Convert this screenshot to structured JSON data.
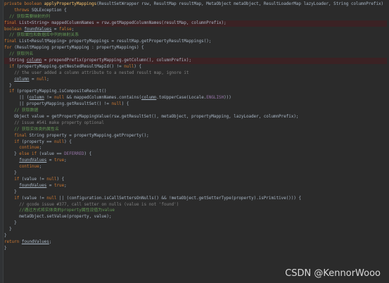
{
  "code_lines": [
    {
      "hl": false,
      "tokens": [
        [
          "kw",
          "private boolean "
        ],
        [
          "fn",
          "applyPropertyMappings"
        ],
        [
          "pl",
          "(ResultSetWrapper rsw, ResultMap resultMap, MetaObject metaObject, ResultLoaderMap lazyLoader, String columnPrefix)"
        ]
      ]
    },
    {
      "hl": false,
      "tokens": [
        [
          "pl",
          "    "
        ],
        [
          "kw",
          "throws "
        ],
        [
          "pl",
          "SQLException {"
        ]
      ]
    },
    {
      "hl": false,
      "tokens": [
        [
          "pl",
          "  "
        ],
        [
          "cmcn",
          "// 获取需要映射的列"
        ]
      ]
    },
    {
      "hl": true,
      "tokens": [
        [
          "kw",
          "final "
        ],
        [
          "pl",
          "List<String> mappedColumnNames = rsw.getMappedColumnNames(resultMap, columnPrefix);"
        ]
      ]
    },
    {
      "hl": false,
      "tokens": [
        [
          "kw",
          "boolean "
        ],
        [
          "un",
          "foundValues"
        ],
        [
          "pl",
          " = "
        ],
        [
          "kw",
          "false"
        ],
        [
          "pl",
          ";"
        ]
      ]
    },
    {
      "hl": false,
      "tokens": [
        [
          "pl",
          "  "
        ],
        [
          "cmcn",
          "// 获取属性和数据库中列的映射关系"
        ]
      ]
    },
    {
      "hl": false,
      "tokens": [
        [
          "kw",
          "final "
        ],
        [
          "pl",
          "List<ResultMapping> propertyMappings = resultMap.getPropertyResultMappings();"
        ]
      ]
    },
    {
      "hl": false,
      "tokens": [
        [
          "kw",
          "for "
        ],
        [
          "pl",
          "(ResultMapping propertyMapping : propertyMappings) {"
        ]
      ]
    },
    {
      "hl": false,
      "tokens": [
        [
          "pl",
          "  "
        ],
        [
          "cmcn",
          "// 获取列名"
        ]
      ]
    },
    {
      "hl": true,
      "tokens": [
        [
          "pl",
          "  String "
        ],
        [
          "un",
          "column"
        ],
        [
          "pl",
          " = prependPrefix(propertyMapping.getColumn(), columnPrefix);"
        ]
      ]
    },
    {
      "hl": false,
      "tokens": [
        [
          "pl",
          "  "
        ],
        [
          "kw",
          "if "
        ],
        [
          "pl",
          "(propertyMapping.getNestedResultMapId() != "
        ],
        [
          "kw",
          "null"
        ],
        [
          "pl",
          ") {"
        ]
      ]
    },
    {
      "hl": false,
      "tokens": [
        [
          "pl",
          "    "
        ],
        [
          "cm",
          "// the user added a column attribute to a nested result map, ignore it"
        ]
      ]
    },
    {
      "hl": false,
      "tokens": [
        [
          "pl",
          "    "
        ],
        [
          "un",
          "column"
        ],
        [
          "pl",
          " = "
        ],
        [
          "kw",
          "null"
        ],
        [
          "pl",
          ";"
        ]
      ]
    },
    {
      "hl": false,
      "tokens": [
        [
          "pl",
          "  }"
        ]
      ]
    },
    {
      "hl": false,
      "tokens": [
        [
          "pl",
          "  "
        ],
        [
          "kw",
          "if "
        ],
        [
          "pl",
          "(propertyMapping.isCompositeResult()"
        ]
      ]
    },
    {
      "hl": false,
      "tokens": [
        [
          "pl",
          "      || ("
        ],
        [
          "un",
          "column"
        ],
        [
          "pl",
          " != "
        ],
        [
          "kw",
          "null "
        ],
        [
          "pl",
          "&& mappedColumnNames.contains("
        ],
        [
          "un",
          "column"
        ],
        [
          "pl",
          ".toUpperCase(Locale."
        ],
        [
          "field",
          "ENGLISH"
        ],
        [
          "pl",
          ")))"
        ]
      ]
    },
    {
      "hl": false,
      "tokens": [
        [
          "pl",
          "      || propertyMapping.getResultSet() != "
        ],
        [
          "kw",
          "null"
        ],
        [
          "pl",
          ") {"
        ]
      ]
    },
    {
      "hl": false,
      "tokens": [
        [
          "pl",
          "    "
        ],
        [
          "cmcn",
          "// 获取数据"
        ]
      ]
    },
    {
      "hl": false,
      "tokens": [
        [
          "pl",
          "    Object value = getPropertyMappingValue(rsw.getResultSet(), metaObject, propertyMapping, lazyLoader, columnPrefix);"
        ]
      ]
    },
    {
      "hl": false,
      "tokens": [
        [
          "pl",
          "    "
        ],
        [
          "cm",
          "// issue #541 make property optional"
        ]
      ]
    },
    {
      "hl": false,
      "tokens": [
        [
          "pl",
          "    "
        ],
        [
          "cmcn",
          "// 获取实体类的属性名"
        ]
      ]
    },
    {
      "hl": false,
      "tokens": [
        [
          "pl",
          "    "
        ],
        [
          "kw",
          "final "
        ],
        [
          "pl",
          "String property = propertyMapping.getProperty();"
        ]
      ]
    },
    {
      "hl": false,
      "tokens": [
        [
          "pl",
          "    "
        ],
        [
          "kw",
          "if "
        ],
        [
          "pl",
          "(property == "
        ],
        [
          "kw",
          "null"
        ],
        [
          "pl",
          ") {"
        ]
      ]
    },
    {
      "hl": false,
      "tokens": [
        [
          "pl",
          "      "
        ],
        [
          "kw",
          "continue"
        ],
        [
          "pl",
          ";"
        ]
      ]
    },
    {
      "hl": false,
      "tokens": [
        [
          "pl",
          "    } "
        ],
        [
          "kw",
          "else if "
        ],
        [
          "pl",
          "(value == "
        ],
        [
          "field",
          "DEFERRED"
        ],
        [
          "pl",
          ") {"
        ]
      ]
    },
    {
      "hl": false,
      "tokens": [
        [
          "pl",
          "      "
        ],
        [
          "un",
          "foundValues"
        ],
        [
          "pl",
          " = "
        ],
        [
          "kw",
          "true"
        ],
        [
          "pl",
          ";"
        ]
      ]
    },
    {
      "hl": false,
      "tokens": [
        [
          "pl",
          "      "
        ],
        [
          "kw",
          "continue"
        ],
        [
          "pl",
          ";"
        ]
      ]
    },
    {
      "hl": false,
      "tokens": [
        [
          "pl",
          "    }"
        ]
      ]
    },
    {
      "hl": false,
      "tokens": [
        [
          "pl",
          "    "
        ],
        [
          "kw",
          "if "
        ],
        [
          "pl",
          "(value != "
        ],
        [
          "kw",
          "null"
        ],
        [
          "pl",
          ") {"
        ]
      ]
    },
    {
      "hl": false,
      "tokens": [
        [
          "pl",
          "      "
        ],
        [
          "un",
          "foundValues"
        ],
        [
          "pl",
          " = "
        ],
        [
          "kw",
          "true"
        ],
        [
          "pl",
          ";"
        ]
      ]
    },
    {
      "hl": false,
      "tokens": [
        [
          "pl",
          "    }"
        ]
      ]
    },
    {
      "hl": false,
      "tokens": [
        [
          "pl",
          "    "
        ],
        [
          "kw",
          "if "
        ],
        [
          "pl",
          "(value != "
        ],
        [
          "kw",
          "null "
        ],
        [
          "pl",
          "|| (configuration.isCallSettersOnNulls() && !metaObject.getSetterType(property).isPrimitive())) {"
        ]
      ]
    },
    {
      "hl": false,
      "tokens": [
        [
          "pl",
          "      "
        ],
        [
          "cm",
          "// gcode issue #377, call setter on nulls (value is not 'found')"
        ]
      ]
    },
    {
      "hl": false,
      "tokens": [
        [
          "pl",
          "      "
        ],
        [
          "cmcn",
          "//通过方式将实体类的property属性设值为value"
        ]
      ]
    },
    {
      "hl": false,
      "tokens": [
        [
          "pl",
          "      metaObject.setValue(property, value);"
        ]
      ]
    },
    {
      "hl": false,
      "tokens": [
        [
          "pl",
          "    }"
        ]
      ]
    },
    {
      "hl": false,
      "tokens": [
        [
          "pl",
          "  }"
        ]
      ]
    },
    {
      "hl": false,
      "tokens": [
        [
          "pl",
          "}"
        ]
      ]
    },
    {
      "hl": false,
      "tokens": [
        [
          "kw",
          "return "
        ],
        [
          "un",
          "foundValues"
        ],
        [
          "pl",
          ";"
        ]
      ]
    },
    {
      "hl": false,
      "tokens": [
        [
          "pl",
          "}"
        ]
      ]
    }
  ],
  "watermark": "CSDN @KennorWooo",
  "colors": {
    "background": "#2b2b2b",
    "keyword": "#cc7832",
    "method": "#ffc66d",
    "comment": "#808080",
    "comment_cn": "#629755",
    "constant": "#9876aa",
    "text": "#a9b7c6",
    "highlight_line": "#3b2224"
  }
}
